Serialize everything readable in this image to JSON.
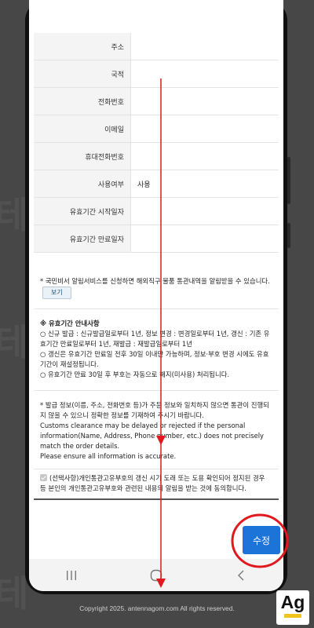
{
  "form": {
    "rows": [
      {
        "label": "주소",
        "value": ""
      },
      {
        "label": "국적",
        "value": ""
      },
      {
        "label": "전화번호",
        "value": ""
      },
      {
        "label": "이메일",
        "value": ""
      },
      {
        "label": "휴대전화번호",
        "value": ""
      },
      {
        "label": "사용여부",
        "value": "사용"
      },
      {
        "label": "유효기간 시작일자",
        "value": ""
      },
      {
        "label": "유효기간 만료일자",
        "value": ""
      }
    ]
  },
  "alert_notice": {
    "text": "* 국민비서 알림서비스를 신청하면 해외직구 물품 통관내역을 알림받을 수 있습니다.",
    "view_button": "보기"
  },
  "validity_notice": {
    "title": "※ 유효기간 안내사항",
    "lines": [
      "○ 신규 발급 : 신규발급일로부터 1년, 정보 변경 : 변경일로부터 1년, 갱신 : 기존 유효기간 만료일로부터 1년, 재발급 : 재발급일로부터 1년",
      "○ 갱신은 유효기간 만료일 전후 30일 이내만 가능하며, 정보·부호 변경 시에도 유효기간이 재설정됩니다.",
      "○ 유효기간 만료 30일 후 부호는 자동으로 해지(미사용) 처리됩니다."
    ]
  },
  "issue_notice": {
    "korean": "* 발급 정보(이름, 주소, 전화번호 등)가 주문 정보와 일치하지 않으면 통관이 진행되지 않을 수 있으니 정확한 정보를 기재하여 주시기 바랍니다.",
    "english": "Customs clearance may be delayed or rejected if the personal information(Name, Address, Phone number, etc.) does not precisely match the order details.",
    "english2": "Please ensure all information is accurate."
  },
  "consent": {
    "text": "(선택사항)개인통관고유부호의 갱신 시기 도래 또는 도용 확인되어 정지된 경우 등 본인의 개인통관고유부호와 관련된 내용의 알림을 받는 것에 동의합니다.",
    "checked": true
  },
  "submit_button": "수정",
  "footer": "Copyright 2025. antennagom.com All rights reserved.",
  "logo": {
    "text": "Ag",
    "accent": "#f0c419"
  },
  "colors": {
    "annotation_red": "#e0191f",
    "primary_blue": "#1c73d8"
  }
}
